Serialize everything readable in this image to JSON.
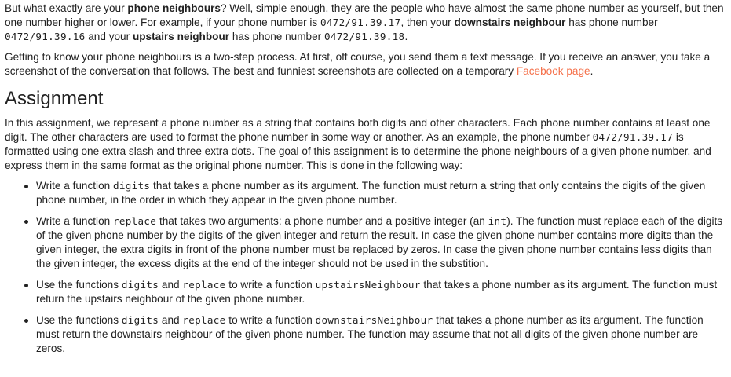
{
  "intro": {
    "p1_a": "But what exactly are your ",
    "p1_b": "phone neighbours",
    "p1_c": "? Well, simple enough, they are the people who have almost the same phone number as yourself, but then one number higher or lower. For example, if your phone number is ",
    "p1_code1": "0472/91.39.17",
    "p1_d": ", then your ",
    "p1_e": "downstairs neighbour",
    "p1_f": " has phone number ",
    "p1_code2": "0472/91.39.16",
    "p1_g": " and your ",
    "p1_h": "upstairs neighbour",
    "p1_i": " has phone number ",
    "p1_code3": "0472/91.39.18",
    "p1_j": ".",
    "p2_a": "Getting to know your phone neighbours is a two-step process. At first, off course, you send them a text message. If you receive an answer, you take a screenshot of the conversation that follows. The best and funniest screenshots are collected on a temporary ",
    "p2_link": "Facebook page",
    "p2_b": "."
  },
  "assignment": {
    "heading": "Assignment",
    "p_a": "In this assignment, we represent a phone number as a string that contains both digits and other characters. Each phone number contains at least one digit. The other characters are used to format the phone number in some way or another. As an example, the phone number ",
    "p_code": "0472/91.39.17",
    "p_b": " is formatted using one extra slash and three extra dots. The goal of this assignment is to determine the phone neighbours of a given phone number, and express them in the same format as the original phone number. This is done in the following way:",
    "items": [
      {
        "a": "Write a function ",
        "code1": "digits",
        "b": " that takes a phone number as its argument. The function must return a string that only contains the digits of the given phone number, in the order in which they appear in the given phone number."
      },
      {
        "a": "Write a function ",
        "code1": "replace",
        "b": " that takes two arguments: a phone number and a positive integer (an ",
        "code2": "int",
        "c": "). The function must replace each of the digits of the given phone number by the digits of the given integer and return the result. In case the given phone number contains more digits than the given integer, the extra digits in front of the phone number must be replaced by zeros. In case the given phone number contains less digits than the given integer, the excess digits at the end of the integer should not be used in the substition."
      },
      {
        "a": "Use the functions ",
        "code1": "digits",
        "b": " and ",
        "code2": "replace",
        "c": " to write a function ",
        "code3": "upstairsNeighbour",
        "d": " that takes a phone number as its argument. The function must return the upstairs neighbour of the given phone number."
      },
      {
        "a": "Use the functions ",
        "code1": "digits",
        "b": " and ",
        "code2": "replace",
        "c": " to write a function ",
        "code3": "downstairsNeighbour",
        "d": " that takes a phone number as its argument. The function must return the downstairs neighbour of the given phone number. The function may assume that not all digits of the given phone number are zeros."
      }
    ]
  },
  "colors": {
    "link": "#f5704a",
    "text": "#212121"
  }
}
